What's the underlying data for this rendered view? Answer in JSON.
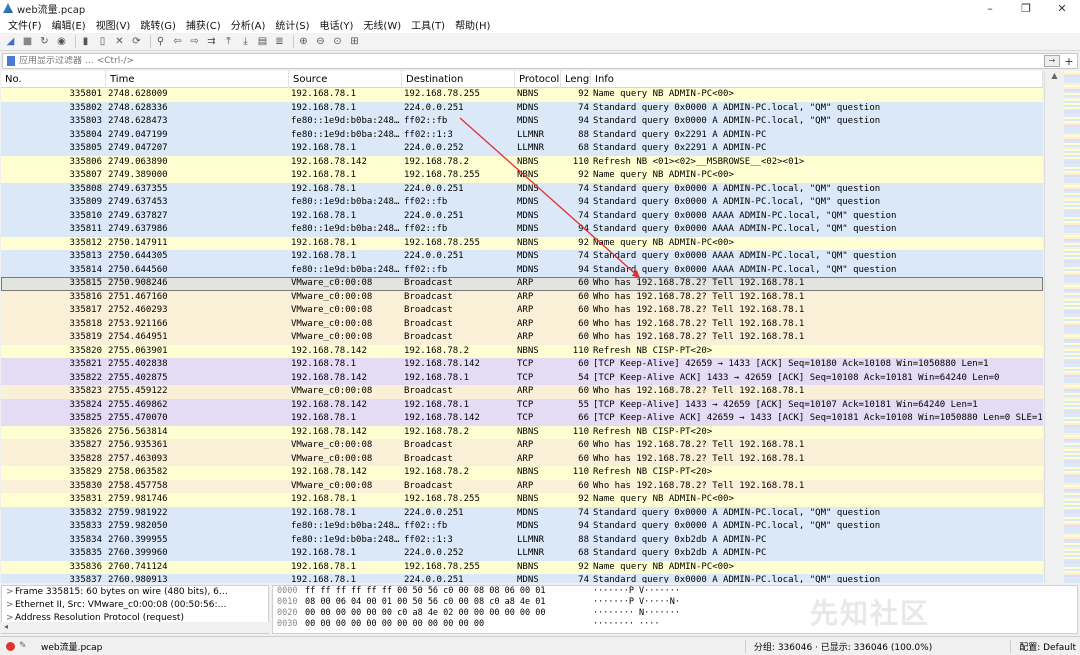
{
  "window": {
    "title": "web流量.pcap",
    "minimize": "–",
    "maximize": "❐",
    "close": "✕"
  },
  "menu": [
    "文件(F)",
    "编辑(E)",
    "视图(V)",
    "跳转(G)",
    "捕获(C)",
    "分析(A)",
    "统计(S)",
    "电话(Y)",
    "无线(W)",
    "工具(T)",
    "帮助(H)"
  ],
  "toolbar_icons": [
    "shark-fin-start-icon",
    "stop-icon",
    "restart-icon",
    "options-icon",
    "open-folder-icon",
    "file-icon",
    "close-file-icon",
    "reload-icon",
    "find-icon",
    "back-icon",
    "forward-icon",
    "go-to-packet-icon",
    "first-packet-icon",
    "last-packet-icon",
    "autoscroll-icon",
    "colorize-icon",
    "zoom-in-icon",
    "zoom-out-icon",
    "normal-size-icon",
    "resize-columns-icon"
  ],
  "filter": {
    "placeholder": "应用显示过滤器 … <Ctrl-/>",
    "arrow": "→",
    "plus": "+"
  },
  "columns": {
    "no": "No.",
    "time": "Time",
    "source": "Source",
    "destination": "Destination",
    "protocol": "Protocol",
    "length": "Length",
    "info": "Info"
  },
  "colors": {
    "nbns": "#fefed2",
    "mdns": "#dae8f7",
    "llmnr": "#dae8f7",
    "arp": "#faf0d8",
    "tcp": "#e4dcf5",
    "selected": "#e2e4e0"
  },
  "packets": [
    {
      "no": "335801",
      "time": "2748.628009",
      "src": "192.168.78.1",
      "dst": "192.168.78.255",
      "proto": "NBNS",
      "len": "92",
      "info": "Name query NB ADMIN-PC<00>"
    },
    {
      "no": "335802",
      "time": "2748.628336",
      "src": "192.168.78.1",
      "dst": "224.0.0.251",
      "proto": "MDNS",
      "len": "74",
      "info": "Standard query 0x0000 A ADMIN-PC.local, \"QM\" question"
    },
    {
      "no": "335803",
      "time": "2748.628473",
      "src": "fe80::1e9d:b0ba:248…",
      "dst": "ff02::fb",
      "proto": "MDNS",
      "len": "94",
      "info": "Standard query 0x0000 A ADMIN-PC.local, \"QM\" question"
    },
    {
      "no": "335804",
      "time": "2749.047199",
      "src": "fe80::1e9d:b0ba:248…",
      "dst": "ff02::1:3",
      "proto": "LLMNR",
      "len": "88",
      "info": "Standard query 0x2291 A ADMIN-PC"
    },
    {
      "no": "335805",
      "time": "2749.047207",
      "src": "192.168.78.1",
      "dst": "224.0.0.252",
      "proto": "LLMNR",
      "len": "68",
      "info": "Standard query 0x2291 A ADMIN-PC"
    },
    {
      "no": "335806",
      "time": "2749.063890",
      "src": "192.168.78.142",
      "dst": "192.168.78.2",
      "proto": "NBNS",
      "len": "110",
      "info": "Refresh NB <01><02>__MSBROWSE__<02><01>"
    },
    {
      "no": "335807",
      "time": "2749.389000",
      "src": "192.168.78.1",
      "dst": "192.168.78.255",
      "proto": "NBNS",
      "len": "92",
      "info": "Name query NB ADMIN-PC<00>"
    },
    {
      "no": "335808",
      "time": "2749.637355",
      "src": "192.168.78.1",
      "dst": "224.0.0.251",
      "proto": "MDNS",
      "len": "74",
      "info": "Standard query 0x0000 A ADMIN-PC.local, \"QM\" question"
    },
    {
      "no": "335809",
      "time": "2749.637453",
      "src": "fe80::1e9d:b0ba:248…",
      "dst": "ff02::fb",
      "proto": "MDNS",
      "len": "94",
      "info": "Standard query 0x0000 A ADMIN-PC.local, \"QM\" question"
    },
    {
      "no": "335810",
      "time": "2749.637827",
      "src": "192.168.78.1",
      "dst": "224.0.0.251",
      "proto": "MDNS",
      "len": "74",
      "info": "Standard query 0x0000 AAAA ADMIN-PC.local, \"QM\" question"
    },
    {
      "no": "335811",
      "time": "2749.637986",
      "src": "fe80::1e9d:b0ba:248…",
      "dst": "ff02::fb",
      "proto": "MDNS",
      "len": "94",
      "info": "Standard query 0x0000 AAAA ADMIN-PC.local, \"QM\" question"
    },
    {
      "no": "335812",
      "time": "2750.147911",
      "src": "192.168.78.1",
      "dst": "192.168.78.255",
      "proto": "NBNS",
      "len": "92",
      "info": "Name query NB ADMIN-PC<00>"
    },
    {
      "no": "335813",
      "time": "2750.644305",
      "src": "192.168.78.1",
      "dst": "224.0.0.251",
      "proto": "MDNS",
      "len": "74",
      "info": "Standard query 0x0000 AAAA ADMIN-PC.local, \"QM\" question"
    },
    {
      "no": "335814",
      "time": "2750.644560",
      "src": "fe80::1e9d:b0ba:248…",
      "dst": "ff02::fb",
      "proto": "MDNS",
      "len": "94",
      "info": "Standard query 0x0000 AAAA ADMIN-PC.local, \"QM\" question"
    },
    {
      "no": "335815",
      "time": "2750.908246",
      "src": "VMware_c0:00:08",
      "dst": "Broadcast",
      "proto": "ARP",
      "len": "60",
      "info": "Who has 192.168.78.2? Tell 192.168.78.1",
      "selected": true
    },
    {
      "no": "335816",
      "time": "2751.467160",
      "src": "VMware_c0:00:08",
      "dst": "Broadcast",
      "proto": "ARP",
      "len": "60",
      "info": "Who has 192.168.78.2? Tell 192.168.78.1"
    },
    {
      "no": "335817",
      "time": "2752.460293",
      "src": "VMware_c0:00:08",
      "dst": "Broadcast",
      "proto": "ARP",
      "len": "60",
      "info": "Who has 192.168.78.2? Tell 192.168.78.1"
    },
    {
      "no": "335818",
      "time": "2753.921166",
      "src": "VMware_c0:00:08",
      "dst": "Broadcast",
      "proto": "ARP",
      "len": "60",
      "info": "Who has 192.168.78.2? Tell 192.168.78.1"
    },
    {
      "no": "335819",
      "time": "2754.464951",
      "src": "VMware_c0:00:08",
      "dst": "Broadcast",
      "proto": "ARP",
      "len": "60",
      "info": "Who has 192.168.78.2? Tell 192.168.78.1"
    },
    {
      "no": "335820",
      "time": "2755.063901",
      "src": "192.168.78.142",
      "dst": "192.168.78.2",
      "proto": "NBNS",
      "len": "110",
      "info": "Refresh NB CISP-PT<20>"
    },
    {
      "no": "335821",
      "time": "2755.402838",
      "src": "192.168.78.1",
      "dst": "192.168.78.142",
      "proto": "TCP",
      "len": "60",
      "info": "[TCP Keep-Alive] 42659 → 1433 [ACK] Seq=10180 Ack=10108 Win=1050880 Len=1"
    },
    {
      "no": "335822",
      "time": "2755.402875",
      "src": "192.168.78.142",
      "dst": "192.168.78.1",
      "proto": "TCP",
      "len": "54",
      "info": "[TCP Keep-Alive ACK] 1433 → 42659 [ACK] Seq=10108 Ack=10181 Win=64240 Len=0"
    },
    {
      "no": "335823",
      "time": "2755.459122",
      "src": "VMware_c0:00:08",
      "dst": "Broadcast",
      "proto": "ARP",
      "len": "60",
      "info": "Who has 192.168.78.2? Tell 192.168.78.1"
    },
    {
      "no": "335824",
      "time": "2755.469862",
      "src": "192.168.78.142",
      "dst": "192.168.78.1",
      "proto": "TCP",
      "len": "55",
      "info": "[TCP Keep-Alive] 1433 → 42659 [ACK] Seq=10107 Ack=10181 Win=64240 Len=1"
    },
    {
      "no": "335825",
      "time": "2755.470070",
      "src": "192.168.78.1",
      "dst": "192.168.78.142",
      "proto": "TCP",
      "len": "66",
      "info": "[TCP Keep-Alive ACK] 42659 → 1433 [ACK] Seq=10181 Ack=10108 Win=1050880 Len=0 SLE=1…"
    },
    {
      "no": "335826",
      "time": "2756.563814",
      "src": "192.168.78.142",
      "dst": "192.168.78.2",
      "proto": "NBNS",
      "len": "110",
      "info": "Refresh NB CISP-PT<20>"
    },
    {
      "no": "335827",
      "time": "2756.935361",
      "src": "VMware_c0:00:08",
      "dst": "Broadcast",
      "proto": "ARP",
      "len": "60",
      "info": "Who has 192.168.78.2? Tell 192.168.78.1"
    },
    {
      "no": "335828",
      "time": "2757.463093",
      "src": "VMware_c0:00:08",
      "dst": "Broadcast",
      "proto": "ARP",
      "len": "60",
      "info": "Who has 192.168.78.2? Tell 192.168.78.1"
    },
    {
      "no": "335829",
      "time": "2758.063582",
      "src": "192.168.78.142",
      "dst": "192.168.78.2",
      "proto": "NBNS",
      "len": "110",
      "info": "Refresh NB CISP-PT<20>"
    },
    {
      "no": "335830",
      "time": "2758.457758",
      "src": "VMware_c0:00:08",
      "dst": "Broadcast",
      "proto": "ARP",
      "len": "60",
      "info": "Who has 192.168.78.2? Tell 192.168.78.1"
    },
    {
      "no": "335831",
      "time": "2759.981746",
      "src": "192.168.78.1",
      "dst": "192.168.78.255",
      "proto": "NBNS",
      "len": "92",
      "info": "Name query NB ADMIN-PC<00>"
    },
    {
      "no": "335832",
      "time": "2759.981922",
      "src": "192.168.78.1",
      "dst": "224.0.0.251",
      "proto": "MDNS",
      "len": "74",
      "info": "Standard query 0x0000 A ADMIN-PC.local, \"QM\" question"
    },
    {
      "no": "335833",
      "time": "2759.982050",
      "src": "fe80::1e9d:b0ba:248…",
      "dst": "ff02::fb",
      "proto": "MDNS",
      "len": "94",
      "info": "Standard query 0x0000 A ADMIN-PC.local, \"QM\" question"
    },
    {
      "no": "335834",
      "time": "2760.399955",
      "src": "fe80::1e9d:b0ba:248…",
      "dst": "ff02::1:3",
      "proto": "LLMNR",
      "len": "88",
      "info": "Standard query 0xb2db A ADMIN-PC"
    },
    {
      "no": "335835",
      "time": "2760.399960",
      "src": "192.168.78.1",
      "dst": "224.0.0.252",
      "proto": "LLMNR",
      "len": "68",
      "info": "Standard query 0xb2db A ADMIN-PC"
    },
    {
      "no": "335836",
      "time": "2760.741124",
      "src": "192.168.78.1",
      "dst": "192.168.78.255",
      "proto": "NBNS",
      "len": "92",
      "info": "Name query NB ADMIN-PC<00>"
    },
    {
      "no": "335837",
      "time": "2760.980913",
      "src": "192.168.78.1",
      "dst": "224.0.0.251",
      "proto": "MDNS",
      "len": "74",
      "info": "Standard query 0x0000 A ADMIN-PC.local, \"QM\" question"
    }
  ],
  "details": [
    {
      "exp": ">",
      "text": "Frame 335815: 60 bytes on wire (480 bits), 6…"
    },
    {
      "exp": ">",
      "text": "Ethernet II, Src: VMware_c0:00:08 (00:50:56:…"
    },
    {
      "exp": ">",
      "text": "Address Resolution Protocol (request)"
    }
  ],
  "hex": [
    {
      "off": "0000",
      "bytes": "ff ff ff ff ff ff 00 50  56 c0 00 08 08 06 00 01",
      "ascii": "·······P V·······"
    },
    {
      "off": "0010",
      "bytes": "08 00 06 04 00 01 00 50  56 c0 00 08 c0 a8 4e 01",
      "ascii": "·······P V·····N·"
    },
    {
      "off": "0020",
      "bytes": "00 00 00 00 00 00 c0 a8  4e 02 00 00 00 00 00 00",
      "ascii": "········ N·······"
    },
    {
      "off": "0030",
      "bytes": "00 00 00 00 00 00 00 00  00 00 00 00",
      "ascii": "········ ····"
    }
  ],
  "watermark": "先知社区",
  "status": {
    "file": "web流量.pcap",
    "packets": "分组: 336046 · 已显示: 336046 (100.0%)",
    "profile": "配置: Default"
  }
}
